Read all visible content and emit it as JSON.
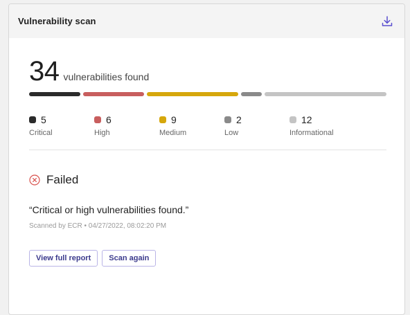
{
  "card": {
    "title": "Vulnerability scan",
    "download_icon": "download-icon"
  },
  "summary": {
    "total": "34",
    "label": "vulnerabilities found"
  },
  "severities": [
    {
      "key": "critical",
      "count": "5",
      "label": "Critical",
      "color": "#2b2b2b",
      "value": 5
    },
    {
      "key": "high",
      "count": "6",
      "label": "High",
      "color": "#c85e5e",
      "value": 6
    },
    {
      "key": "medium",
      "count": "9",
      "label": "Medium",
      "color": "#d6a70c",
      "value": 9
    },
    {
      "key": "low",
      "count": "2",
      "label": "Low",
      "color": "#8a8a8a",
      "value": 2
    },
    {
      "key": "informational",
      "count": "12",
      "label": "Informational",
      "color": "#c4c4c4",
      "value": 12
    }
  ],
  "status": {
    "icon": "failed-x-circle-icon",
    "icon_color": "#d9534f",
    "text": "Failed"
  },
  "result": {
    "message": "“Critical or high vulnerabilities found.”",
    "meta": "Scanned by ECR • 04/27/2022, 08:02:20 PM"
  },
  "actions": {
    "view_report": "View full report",
    "scan_again": "Scan again"
  }
}
